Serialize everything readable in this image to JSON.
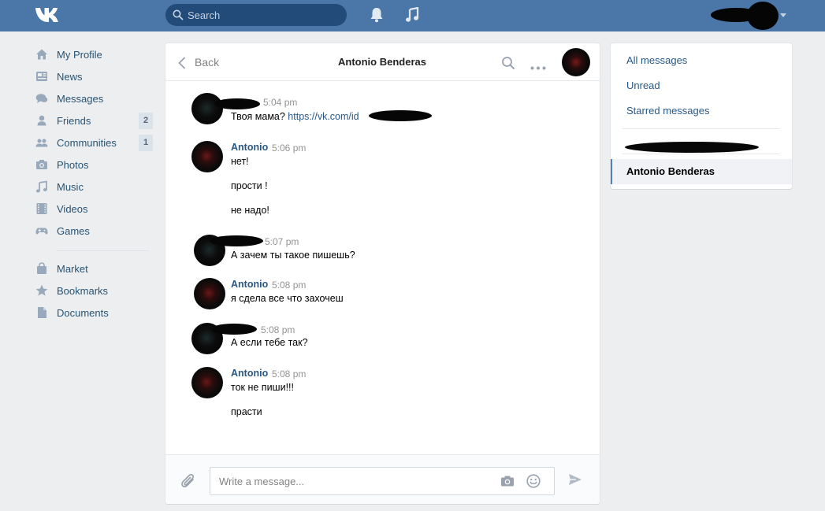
{
  "header": {
    "search_placeholder": "Search"
  },
  "nav": {
    "items": [
      {
        "label": "My Profile",
        "icon": "home-icon"
      },
      {
        "label": "News",
        "icon": "news-icon"
      },
      {
        "label": "Messages",
        "icon": "messages-icon"
      },
      {
        "label": "Friends",
        "icon": "friends-icon",
        "count": "2"
      },
      {
        "label": "Communities",
        "icon": "communities-icon",
        "count": "1"
      },
      {
        "label": "Photos",
        "icon": "camera-icon"
      },
      {
        "label": "Music",
        "icon": "music-note-icon"
      },
      {
        "label": "Videos",
        "icon": "film-icon"
      },
      {
        "label": "Games",
        "icon": "gamepad-icon"
      },
      {
        "label": "Market",
        "icon": "bag-icon"
      },
      {
        "label": "Bookmarks",
        "icon": "star-icon"
      },
      {
        "label": "Documents",
        "icon": "document-icon"
      }
    ]
  },
  "chat": {
    "back_label": "Back",
    "title": "Antonio Benderas",
    "messages": [
      {
        "author": "",
        "time": "5:04 pm",
        "lines": [
          "Твоя мама? "
        ],
        "link": "https://vk.com/id"
      },
      {
        "author": "Antonio",
        "time": "5:06 pm",
        "lines": [
          "нет!",
          "прости !",
          "не надо!"
        ]
      },
      {
        "author": "",
        "time": "5:07 pm",
        "lines": [
          "А зачем ты такое пишешь?"
        ]
      },
      {
        "author": "Antonio",
        "time": "5:08 pm",
        "lines": [
          "я сдела все что захочеш"
        ]
      },
      {
        "author": "",
        "time": "5:08 pm",
        "lines": [
          "А если тебе так?"
        ]
      },
      {
        "author": "Antonio",
        "time": "5:08 pm",
        "lines": [
          "ток не пиши!!!",
          "прасти"
        ]
      }
    ],
    "input_placeholder": "Write a message..."
  },
  "right_panel": {
    "all_messages": "All messages",
    "unread": "Unread",
    "starred": "Starred messages",
    "active_conversation": "Antonio Benderas"
  },
  "colors": {
    "header": "#4a76a8",
    "link": "#2a5885",
    "background": "#edeef0"
  }
}
